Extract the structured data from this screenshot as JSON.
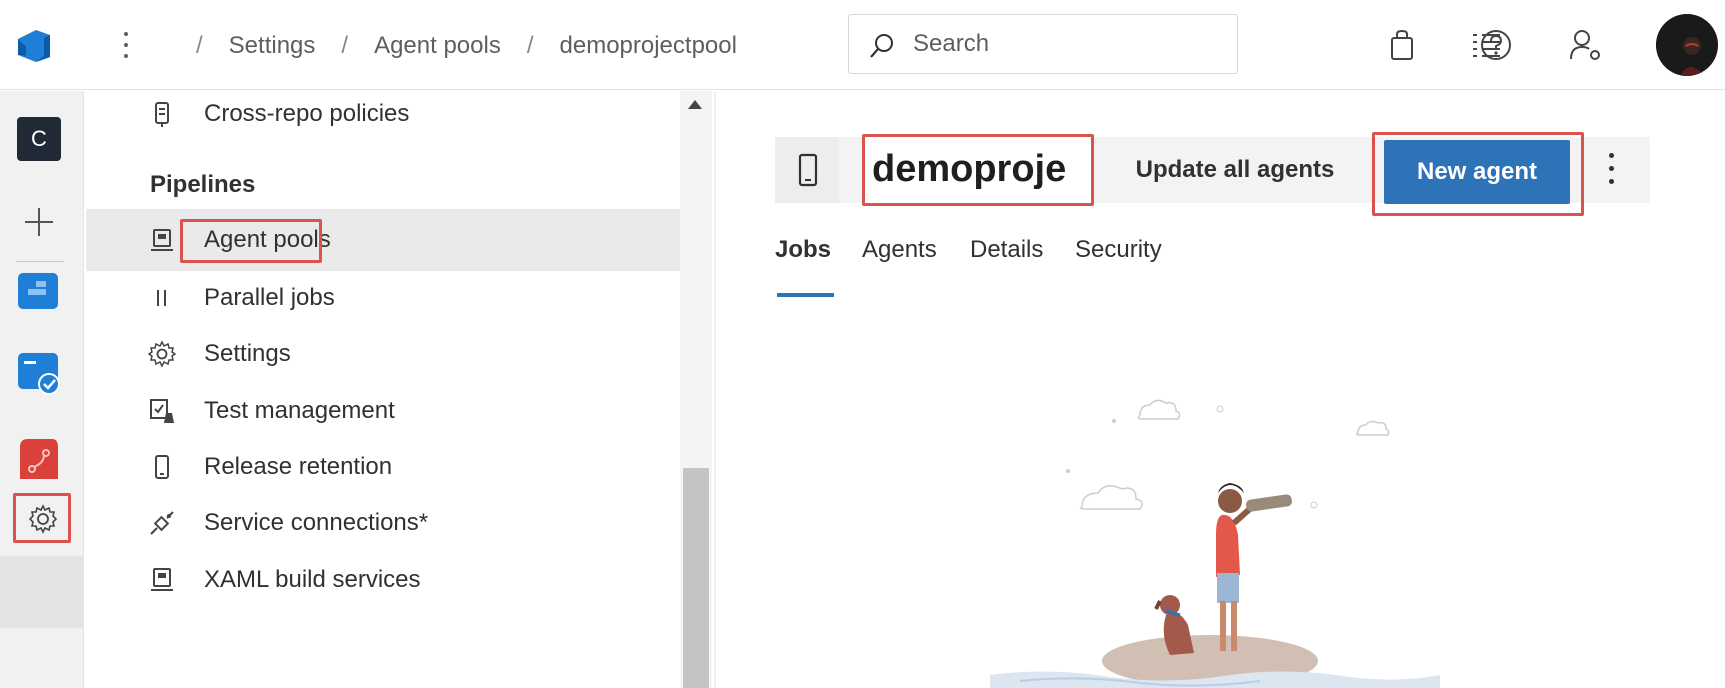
{
  "topbar": {
    "breadcrumbs": [
      "Settings",
      "Agent pools",
      "demoprojectpool"
    ],
    "separator": "/",
    "search_placeholder": "Search",
    "icons": [
      "list-icon",
      "shopping-bag-icon",
      "help-icon",
      "user-settings-icon"
    ]
  },
  "rail": {
    "org_initial": "C",
    "items": [
      "add-icon",
      "boards-icon",
      "test-plans-icon",
      "artifacts-icon",
      "settings-icon"
    ]
  },
  "sidebar": {
    "top_item": {
      "label": "Cross-repo policies",
      "icon": "policy-icon"
    },
    "section_header": "Pipelines",
    "items": [
      {
        "label": "Agent pools",
        "icon": "agent-pool-icon",
        "selected": true
      },
      {
        "label": "Parallel jobs",
        "icon": "parallel-icon"
      },
      {
        "label": "Settings",
        "icon": "gear-icon"
      },
      {
        "label": "Test management",
        "icon": "test-management-icon"
      },
      {
        "label": "Release retention",
        "icon": "phone-icon"
      },
      {
        "label": "Service connections*",
        "icon": "plug-icon"
      },
      {
        "label": "XAML build services",
        "icon": "build-icon"
      }
    ]
  },
  "main": {
    "pool_name": "demoproje",
    "update_button": "Update all agents",
    "new_agent_button": "New agent",
    "tabs": [
      "Jobs",
      "Agents",
      "Details",
      "Security"
    ],
    "active_tab": "Jobs"
  },
  "colors": {
    "accent": "#2e72b8",
    "highlight": "#d9534f"
  }
}
